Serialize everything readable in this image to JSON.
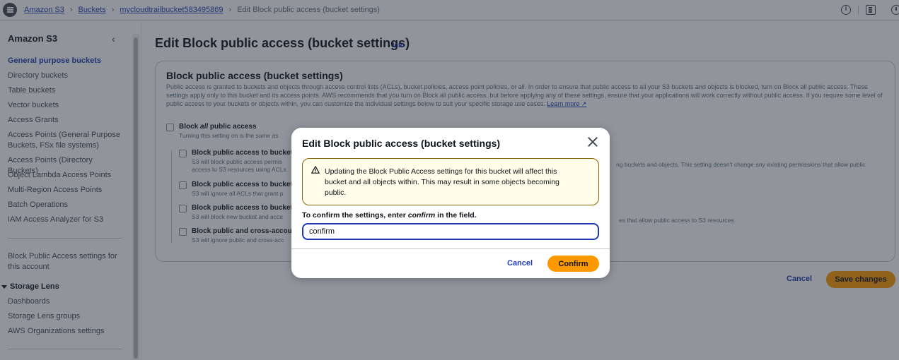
{
  "breadcrumb": {
    "items": [
      "Amazon S3",
      "Buckets",
      "mycloudtrailbucket583495869"
    ],
    "current": "Edit Block public access (bucket settings)"
  },
  "sidebar": {
    "title": "Amazon S3",
    "items": [
      "General purpose buckets",
      "Directory buckets",
      "Table buckets",
      "Vector buckets",
      "Access Grants",
      "Access Points (General Purpose Buckets, FSx file systems)",
      "Access Points (Directory Buckets)",
      "Object Lambda Access Points",
      "Multi-Region Access Points",
      "Batch Operations",
      "IAM Access Analyzer for S3"
    ],
    "account_item": "Block Public Access settings for this account",
    "storage_lens": {
      "label": "Storage Lens",
      "items": [
        "Dashboards",
        "Storage Lens groups",
        "AWS Organizations settings"
      ]
    }
  },
  "main": {
    "title": "Edit Block public access (bucket settings)",
    "info_link": "Info",
    "panel_title": "Block public access (bucket settings)",
    "panel_desc": "Public access is granted to buckets and objects through access control lists (ACLs), bucket policies, access point policies, or all. In order to ensure that public access to all your S3 buckets and objects is blocked, turn on Block all public access. These settings apply only to this bucket and its access points. AWS recommends that you turn on Block all public access, but before applying any of these settings, ensure that your applications will work correctly without public access. If you require some level of public access to your buckets or objects within, you can customize the individual settings below to suit your specific storage use cases.",
    "learn_more": "Learn more",
    "block_all": {
      "label_pre": "Block ",
      "label_em": "all",
      "label_post": " public access",
      "desc": "Turning this setting on is the same as"
    },
    "options": [
      {
        "label": "Block public access to bucket",
        "desc_left": "S3 will block public access permis",
        "desc_left2": "access to S3 resources using ACLs.",
        "desc_right": "ng buckets and objects. This setting doesn't change any existing permissions that allow public"
      },
      {
        "label": "Block public access to bucket",
        "desc_left": "S3 will ignore all ACLs that grant p",
        "desc_right": ""
      },
      {
        "label": "Block public access to bucket",
        "desc_left": "S3 will block new bucket and acce",
        "desc_right": "es that allow public access to S3 resources."
      },
      {
        "label": "Block public and cross-accou",
        "desc_left": "S3 will ignore public and cross-acc",
        "desc_right": ""
      }
    ],
    "cancel": "Cancel",
    "save": "Save changes"
  },
  "modal": {
    "title": "Edit Block public access (bucket settings)",
    "alert": "Updating the Block Public Access settings for this bucket will affect this bucket and all objects within. This may result in some objects becoming public.",
    "confirm_label_pre": "To confirm the settings, enter ",
    "confirm_label_em": "confirm",
    "confirm_label_post": " in the field.",
    "input_value": "confirm",
    "cancel": "Cancel",
    "confirm": "Confirm"
  },
  "colors": {
    "link": "#1f3bb3",
    "primary_button": "#ff9900",
    "warning_border": "#8d6605",
    "warning_bg": "#fffce9"
  }
}
